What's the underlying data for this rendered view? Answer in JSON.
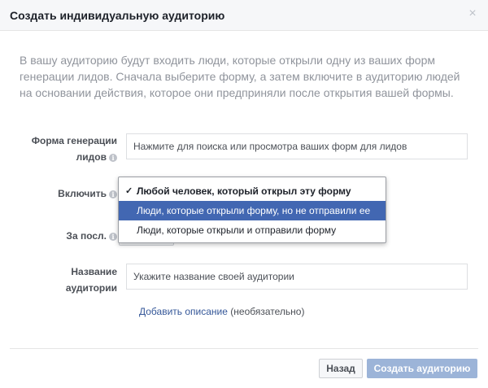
{
  "dialog": {
    "title": "Создать индивидуальную аудиторию",
    "close_glyph": "×"
  },
  "intro": {
    "text": "В вашу аудиторию будут входить люди, которые открыли одну из ваших форм генерации лидов. Сначала выберите форму, а затем включите в аудиторию людей на основании действия, которое они предприняли после открытия вашей формы."
  },
  "form": {
    "lead_form_label_line1": "Форма генерации",
    "lead_form_label_line2": "лидов",
    "lead_form_placeholder": "Нажмите для поиска или просмотра ваших форм для лидов",
    "include_label": "Включить",
    "period_label": "За посл.",
    "name_label_line1": "Название",
    "name_label_line2": "аудитории",
    "name_placeholder": "Укажите название своей аудитории",
    "add_description_link": "Добавить описание",
    "optional_text": "(необязательно)"
  },
  "dropdown": {
    "options": [
      {
        "label": "Любой человек, который открыл эту форму",
        "selected": true,
        "highlighted": false
      },
      {
        "label": "Люди, которые открыли форму, но не отправили ее",
        "selected": false,
        "highlighted": true
      },
      {
        "label": "Люди, которые открыли и отправили форму",
        "selected": false,
        "highlighted": false
      }
    ],
    "check_glyph": "✓"
  },
  "footer": {
    "back_label": "Назад",
    "create_label": "Создать аудиторию"
  },
  "icons": {
    "info_glyph": "i"
  },
  "colors": {
    "accent": "#4267b2",
    "link": "#365899",
    "disabled_primary": "#9cb4d8"
  }
}
